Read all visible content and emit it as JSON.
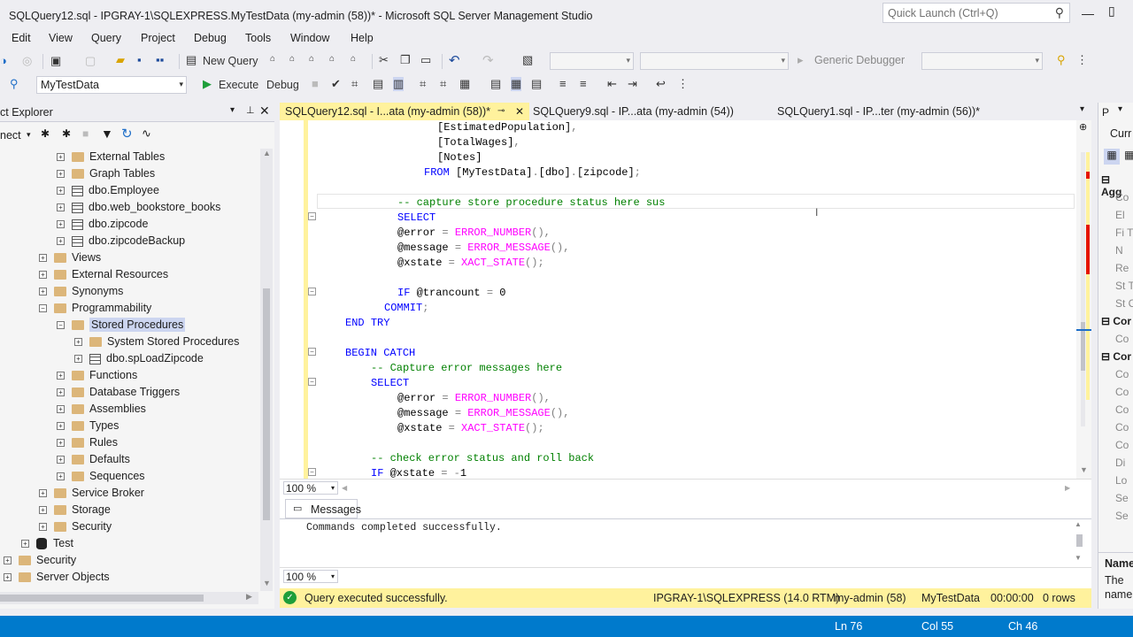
{
  "window": {
    "title": "SQLQuery12.sql - IPGRAY-1\\SQLEXPRESS.MyTestData (my-admin (58))* - Microsoft SQL Server Management Studio",
    "quick_launch_placeholder": "Quick Launch (Ctrl+Q)"
  },
  "menu": [
    "Edit",
    "View",
    "Query",
    "Project",
    "Debug",
    "Tools",
    "Window",
    "Help"
  ],
  "toolbar1": {
    "new_query": "New Query",
    "debugger": "Generic Debugger"
  },
  "toolbar2": {
    "database": "MyTestData",
    "execute": "Execute",
    "debug": "Debug"
  },
  "object_explorer": {
    "title": "ct Explorer",
    "connect": "nect",
    "nodes": [
      {
        "label": "External Tables",
        "kind": "folder",
        "exp": "+"
      },
      {
        "label": "Graph Tables",
        "kind": "folder",
        "exp": "+"
      },
      {
        "label": "dbo.Employee",
        "kind": "table",
        "exp": "+"
      },
      {
        "label": "dbo.web_bookstore_books",
        "kind": "table",
        "exp": "+"
      },
      {
        "label": "dbo.zipcode",
        "kind": "table",
        "exp": "+"
      },
      {
        "label": "dbo.zipcodeBackup",
        "kind": "table",
        "exp": "+"
      },
      {
        "label": "Views",
        "kind": "folder",
        "exp": "+"
      },
      {
        "label": "External Resources",
        "kind": "folder",
        "exp": "+"
      },
      {
        "label": "Synonyms",
        "kind": "folder",
        "exp": "+"
      },
      {
        "label": "Programmability",
        "kind": "folder",
        "exp": "−"
      },
      {
        "label": "Stored Procedures",
        "kind": "folder",
        "exp": "−"
      },
      {
        "label": "System Stored Procedures",
        "kind": "folder",
        "exp": "+"
      },
      {
        "label": "dbo.spLoadZipcode",
        "kind": "table",
        "exp": "+"
      },
      {
        "label": "Functions",
        "kind": "folder",
        "exp": "+"
      },
      {
        "label": "Database Triggers",
        "kind": "folder",
        "exp": "+"
      },
      {
        "label": "Assemblies",
        "kind": "folder",
        "exp": "+"
      },
      {
        "label": "Types",
        "kind": "folder",
        "exp": "+"
      },
      {
        "label": "Rules",
        "kind": "folder",
        "exp": "+"
      },
      {
        "label": "Defaults",
        "kind": "folder",
        "exp": "+"
      },
      {
        "label": "Sequences",
        "kind": "folder",
        "exp": "+"
      },
      {
        "label": "Service Broker",
        "kind": "folder",
        "exp": "+"
      },
      {
        "label": "Storage",
        "kind": "folder",
        "exp": "+"
      },
      {
        "label": "Security",
        "kind": "folder",
        "exp": "+"
      },
      {
        "label": "Test",
        "kind": "db",
        "exp": "+"
      },
      {
        "label": "Security",
        "kind": "folder",
        "exp": "+"
      },
      {
        "label": "Server Objects",
        "kind": "folder",
        "exp": "+"
      }
    ]
  },
  "tabs": [
    "SQLQuery12.sql - I...ata (my-admin (58))*",
    "SQLQuery9.sql - IP...ata (my-admin (54))",
    "SQLQuery1.sql - IP...ter (my-admin (56))*"
  ],
  "code_lines": [
    "[EstimatedPopulation],",
    "[TotalWages],",
    "[Notes]",
    "FROM [MyTestData].[dbo].[zipcode];",
    "",
    "-- capture store procedure status here sus",
    "SELECT",
    "@error = ERROR_NUMBER(),",
    "@message = ERROR_MESSAGE(),",
    "@xstate = XACT_STATE();",
    "",
    "IF @trancount = 0",
    "COMMIT;",
    "END TRY",
    "",
    "BEGIN CATCH",
    "-- Capture error messages here",
    "SELECT",
    "@error = ERROR_NUMBER(),",
    "@message = ERROR_MESSAGE(),",
    "@xstate = XACT_STATE();",
    "",
    "-- check error status and roll back",
    "IF @xstate = -1"
  ],
  "zoom": "100 %",
  "messages_tab": "Messages",
  "message_text": "Commands completed successfully.",
  "query_status": {
    "text": "Query executed successfully.",
    "server": "IPGRAY-1\\SQLEXPRESS (14.0 RTM)",
    "user": "my-admin (58)",
    "db": "MyTestData",
    "time": "00:00:00",
    "rows": "0 rows"
  },
  "statusbar": {
    "ln": "Ln 76",
    "col": "Col 55",
    "ch": "Ch 46"
  },
  "properties": {
    "title": "P",
    "curr": "Curr",
    "sections": [
      "Agg",
      "Cor",
      "Cor"
    ],
    "rows": [
      "Co",
      "El",
      "Fi T",
      "N",
      "Re",
      "St T",
      "St C",
      "Co",
      "Co",
      "Co",
      "Co",
      "Co",
      "Co",
      "Di",
      "Lo",
      "Se",
      "Se"
    ],
    "name_label": "Name",
    "desc1": "The",
    "desc2": "name"
  },
  "colors": {
    "accent": "#007acc",
    "tab_active": "#fff29d",
    "status_query": "#fff29d"
  }
}
